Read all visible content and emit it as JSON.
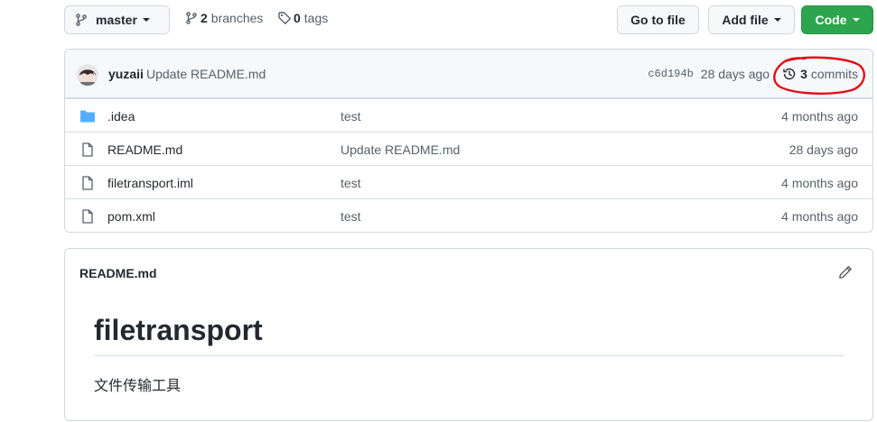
{
  "toolbar": {
    "branch_label": "master",
    "branches_count": "2",
    "branches_label": "branches",
    "tags_count": "0",
    "tags_label": "tags",
    "goto_file": "Go to file",
    "add_file": "Add file",
    "code": "Code"
  },
  "latest_commit": {
    "author": "yuzaii",
    "message": "Update README.md",
    "sha": "c6d194b",
    "time": "28 days ago",
    "commits_count": "3",
    "commits_label": "commits"
  },
  "files": [
    {
      "name": ".idea",
      "type": "folder",
      "message": "test",
      "age": "4 months ago"
    },
    {
      "name": "README.md",
      "type": "file",
      "message": "Update README.md",
      "age": "28 days ago"
    },
    {
      "name": "filetransport.iml",
      "type": "file",
      "message": "test",
      "age": "4 months ago"
    },
    {
      "name": "pom.xml",
      "type": "file",
      "message": "test",
      "age": "4 months ago"
    }
  ],
  "readme": {
    "title": "README.md",
    "heading": "filetransport",
    "body": "文件传输工具"
  },
  "colors": {
    "accent_green": "#2da44e",
    "folder_blue": "#54aeff",
    "annotation_red": "#e0101a"
  }
}
